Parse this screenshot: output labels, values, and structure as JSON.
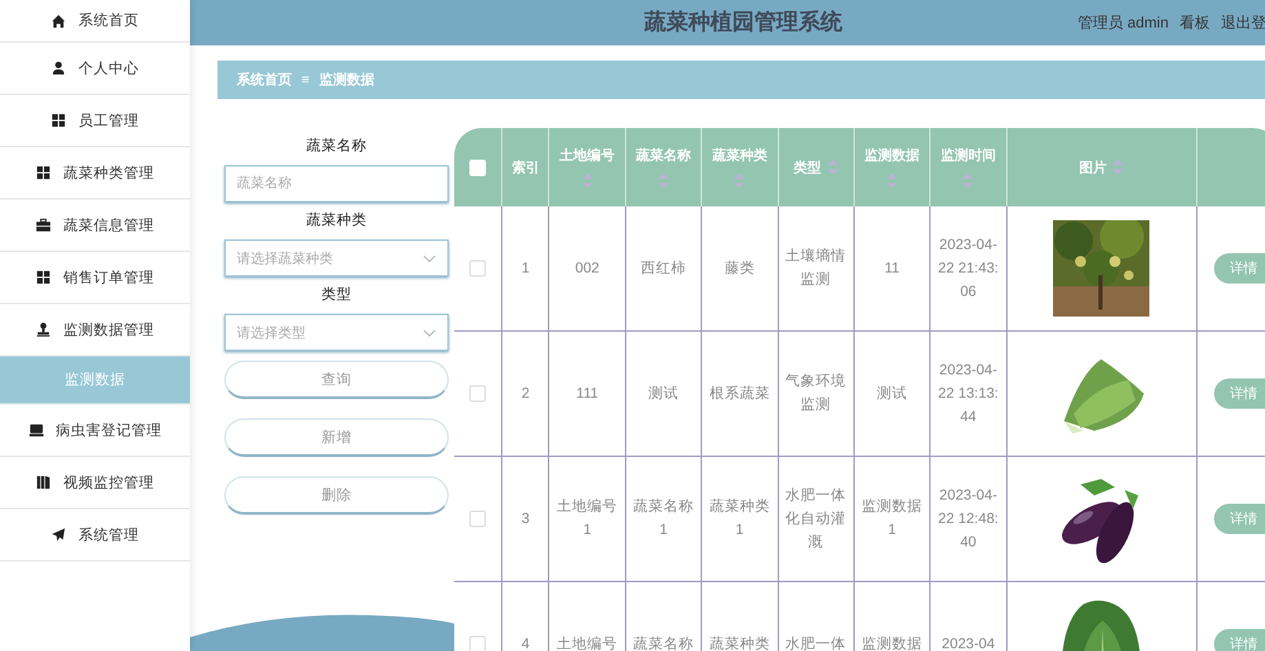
{
  "sidebar": {
    "items": [
      {
        "label": "系统首页",
        "selected": false
      },
      {
        "label": "个人中心",
        "selected": false
      },
      {
        "label": "员工管理",
        "selected": false
      },
      {
        "label": "蔬菜种类管理",
        "selected": false
      },
      {
        "label": "蔬菜信息管理",
        "selected": false
      },
      {
        "label": "销售订单管理",
        "selected": false
      },
      {
        "label": "监测数据管理",
        "selected": false,
        "children": [
          {
            "label": "监测数据",
            "selected": true
          }
        ]
      },
      {
        "label": "病虫害登记管理",
        "selected": false
      },
      {
        "label": "视频监控管理",
        "selected": false
      },
      {
        "label": "系统管理",
        "selected": false
      }
    ]
  },
  "header": {
    "title": "蔬菜种植园管理系统",
    "user": "管理员 admin",
    "links": [
      "看板",
      "退出登"
    ]
  },
  "breadcrumb": {
    "items": [
      "系统首页",
      "监测数据"
    ],
    "separator": "≡"
  },
  "search": {
    "fields": [
      {
        "label": "蔬菜名称",
        "kind": "input",
        "placeholder": "蔬菜名称"
      },
      {
        "label": "蔬菜种类",
        "kind": "select",
        "placeholder": "请选择蔬菜种类"
      },
      {
        "label": "类型",
        "kind": "select",
        "placeholder": "请选择类型"
      }
    ],
    "buttons": [
      "查询",
      "新增",
      "删除"
    ]
  },
  "table": {
    "header_checked": false,
    "columns": [
      {
        "label": "索引",
        "sortable": false
      },
      {
        "label": "土地编号",
        "sortable": true
      },
      {
        "label": "蔬菜名称",
        "sortable": true
      },
      {
        "label": "蔬菜种类",
        "sortable": true
      },
      {
        "label": "类型",
        "sortable": true
      },
      {
        "label": "监测数据",
        "sortable": true
      },
      {
        "label": "监测时间",
        "sortable": true
      },
      {
        "label": "图片",
        "sortable": true
      }
    ],
    "rows": [
      {
        "checked": false,
        "cells": [
          "1",
          "002",
          "西红柿",
          "藤类",
          "土壤墒情监测",
          "11",
          "2023-04-22 21:43:06"
        ],
        "action": "详情"
      },
      {
        "checked": false,
        "cells": [
          "2",
          "111",
          "测试",
          "根系蔬菜",
          "气象环境监测",
          "测试",
          "2023-04-22 13:13:44"
        ],
        "action": "详情"
      },
      {
        "checked": false,
        "cells": [
          "3",
          "土地编号1",
          "蔬菜名称1",
          "蔬菜种类1",
          "水肥一体化自动灌溉",
          "监测数据1",
          "2023-04-22 12:48:40"
        ],
        "action": "详情"
      },
      {
        "checked": false,
        "cells": [
          "4",
          "土地编号",
          "蔬菜名称",
          "蔬菜种类",
          "水肥一体",
          "监测数据",
          "2023-04"
        ],
        "action": "详情"
      }
    ]
  }
}
